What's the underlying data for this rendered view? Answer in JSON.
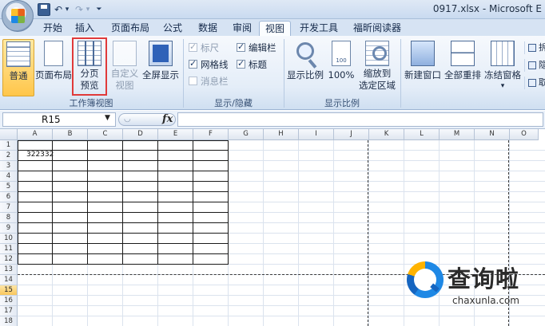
{
  "titlebar": {
    "title": "0917.xlsx - Microsoft E",
    "quick_access": {
      "undo_glyph": "↶",
      "redo_glyph": "↷",
      "dropdown_glyph": "▾",
      "customize_glyph": "⏷"
    }
  },
  "tabs": [
    {
      "label": "开始",
      "active": false
    },
    {
      "label": "插入",
      "active": false
    },
    {
      "label": "页面布局",
      "active": false
    },
    {
      "label": "公式",
      "active": false
    },
    {
      "label": "数据",
      "active": false
    },
    {
      "label": "审阅",
      "active": false
    },
    {
      "label": "视图",
      "active": true
    },
    {
      "label": "开发工具",
      "active": false
    },
    {
      "label": "福昕阅读器",
      "active": false
    }
  ],
  "ribbon": {
    "workbook_views": {
      "label": "工作簿视图",
      "normal": "普通",
      "page_layout": "页面布局",
      "page_break_line1": "分页",
      "page_break_line2": "预览",
      "custom_line1": "自定义",
      "custom_line2": "视图",
      "full_screen": "全屏显示"
    },
    "show_hide": {
      "label": "显示/隐藏",
      "ruler": "标尺",
      "formula_bar": "编辑栏",
      "gridlines": "网格线",
      "headings": "标题",
      "message_bar": "消息栏"
    },
    "zoom": {
      "label": "显示比例",
      "zoom": "显示比例",
      "zoom_100": "100%",
      "zoom_sel_line1": "缩放到",
      "zoom_sel_line2": "选定区域"
    },
    "window": {
      "new_window": "新建窗口",
      "arrange_all": "全部重排",
      "freeze_panes": "冻结窗格",
      "freeze_dropdown": "▾",
      "split_cut": "拆",
      "hide_cut": "隐",
      "unhide_cut": "取"
    }
  },
  "formula_bar": {
    "name_box": "R15",
    "name_box_arrow": "▼",
    "fx_label": "fx",
    "pill_mark": "◡",
    "value": ""
  },
  "grid": {
    "columns": [
      "A",
      "B",
      "C",
      "D",
      "E",
      "F",
      "G",
      "H",
      "I",
      "J",
      "K",
      "L",
      "M",
      "N",
      "O"
    ],
    "rows": [
      "1",
      "2",
      "3",
      "4",
      "5",
      "6",
      "7",
      "8",
      "9",
      "10",
      "11",
      "12",
      "13",
      "14",
      "15",
      "16",
      "17",
      "18"
    ],
    "cell_A2": "322332"
  },
  "watermark": {
    "text": "查询啦",
    "url": "chaxunla.com"
  }
}
